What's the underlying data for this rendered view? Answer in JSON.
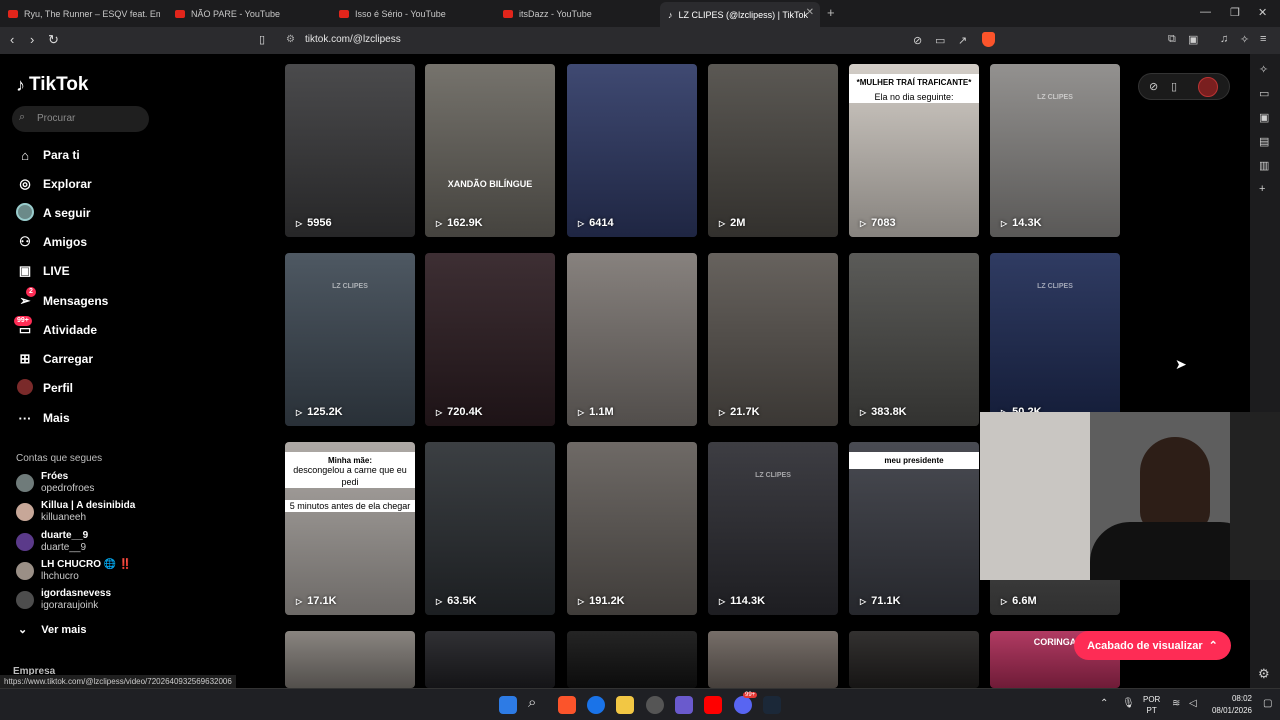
{
  "browser": {
    "tabs": [
      {
        "title": "Ryu, The Runner – ESQV feat. Emitê (",
        "icon": "youtube-icon"
      },
      {
        "title": "NÃO PARE - YouTube",
        "icon": "youtube-icon"
      },
      {
        "title": "Isso é Sério - YouTube",
        "icon": "youtube-icon"
      },
      {
        "title": "itsDazz - YouTube",
        "icon": "youtube-icon"
      },
      {
        "title": "LZ CLIPES (@lzclipess) | TikTok",
        "icon": "tiktok-icon",
        "active": true
      }
    ],
    "new_tab_label": "+",
    "url": "tiktok.com/@lzclipess",
    "status_url": "https://www.tiktok.com/@lzclipess/video/7202640932569632006"
  },
  "sidebar": {
    "logo_text": "TikTok",
    "search_placeholder": "Procurar",
    "nav": [
      {
        "label": "Para ti",
        "icon": "home-icon"
      },
      {
        "label": "Explorar",
        "icon": "compass-icon"
      },
      {
        "label": "A seguir",
        "icon": "following-avatar-icon"
      },
      {
        "label": "Amigos",
        "icon": "friends-icon"
      },
      {
        "label": "LIVE",
        "icon": "live-icon"
      },
      {
        "label": "Mensagens",
        "icon": "send-icon",
        "badge": "2"
      },
      {
        "label": "Atividade",
        "icon": "inbox-icon",
        "badge": "99+"
      },
      {
        "label": "Carregar",
        "icon": "upload-icon"
      },
      {
        "label": "Perfil",
        "icon": "profile-avatar-icon"
      },
      {
        "label": "Mais",
        "icon": "more-dots-icon"
      }
    ],
    "following_title": "Contas que segues",
    "following": [
      {
        "name": "Fróes",
        "handle": "opedrofroes",
        "color": "#6f7b7a"
      },
      {
        "name": "Killua | A desinibida",
        "handle": "killuaneeh",
        "color": "#c7a798"
      },
      {
        "name": "duarte__9",
        "handle": "duarte__9",
        "color": "#5b3a8a"
      },
      {
        "name": "LH CHUCRO 🌐 ‼️",
        "handle": "lhchucro",
        "color": "#9a8f86"
      },
      {
        "name": "igordasnevess",
        "handle": "igoraraujoink",
        "color": "#4d4d4d"
      }
    ],
    "see_more": "Ver mais",
    "company": "Empresa"
  },
  "videos": [
    {
      "views": "5956",
      "color": "#3b3b3d"
    },
    {
      "views": "162.9K",
      "color": "#6a6760",
      "caption_overlay": "XANDÃO BILÍNGUE"
    },
    {
      "views": "6414",
      "color": "#2f3a66"
    },
    {
      "views": "2M",
      "color": "#4d4a45"
    },
    {
      "views": "7083",
      "color": "#cfc9c2",
      "caption": "*MULHER TRAÍ TRAFICANTE*",
      "caption2": "Ela no dia seguinte:"
    },
    {
      "views": "14.3K",
      "color": "#8a8886",
      "watermark": "LZ CLIPES"
    },
    {
      "views": "125.2K",
      "color": "#3f4a55",
      "watermark": "LZ CLIPES"
    },
    {
      "views": "720.4K",
      "color": "#2d1d22"
    },
    {
      "views": "1.1M",
      "color": "#7d7773"
    },
    {
      "views": "21.7K",
      "color": "#5a5550"
    },
    {
      "views": "383.8K",
      "color": "#4d4d4a"
    },
    {
      "views": "50.2K",
      "color": "#1e2b55",
      "watermark": "LZ CLIPES"
    },
    {
      "views": "17.1K",
      "color": "#a7a29e",
      "caption": "Minha mãe:",
      "caption2": "descongelou a carne que eu pedi",
      "caption3": "5 minutos antes de ela chegar"
    },
    {
      "views": "63.5K",
      "color": "#2b2f33"
    },
    {
      "views": "191.2K",
      "color": "#625d59"
    },
    {
      "views": "114.3K",
      "color": "#2d2d33",
      "watermark": "LZ CLIPES"
    },
    {
      "views": "71.1K",
      "color": "#3a3c44",
      "caption": "meu presidente"
    },
    {
      "views": "6.6M",
      "color": "#4a4a4a"
    },
    {
      "views": "",
      "color": "#7f7a75"
    },
    {
      "views": "",
      "color": "#1f1f23"
    },
    {
      "views": "",
      "color": "#121212"
    },
    {
      "views": "",
      "color": "#6b625c"
    },
    {
      "views": "",
      "color": "#22201f"
    },
    {
      "views": "",
      "color": "#aa2a55",
      "caption_overlay": "CORINGA"
    }
  ],
  "finished_button": "Acabado de visualizar",
  "taskbar": {
    "language": "POR",
    "layout": "PT",
    "time": "08:02",
    "date": "08/01/2026",
    "discord_badge": "99+"
  }
}
